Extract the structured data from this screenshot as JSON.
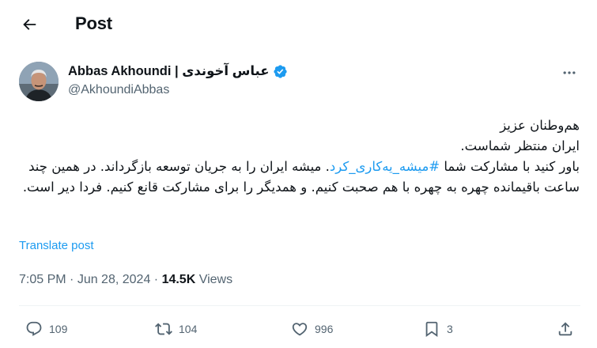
{
  "header": {
    "title": "Post"
  },
  "author": {
    "display_name": "Abbas Akhoundi | عباس آخوندی",
    "handle": "@AkhoundiAbbas"
  },
  "tweet": {
    "line1": "هم‌وطنان عزیز",
    "line2": "ایران منتظر شماست.",
    "para_part1": "باور کنید با مشارکت شما ",
    "hashtag": "#میشه_یه‌کاری_کرد",
    "para_part2": ". میشه ایران را به جریان توسعه بازگرداند. در همین چند ساعت باقیمانده چهره به چهره با هم صحبت کنیم. و همدیگر را برای مشارکت قانع کنیم. فردا دیر است."
  },
  "translate_label": "Translate post",
  "meta": {
    "time": "7:05 PM",
    "separator": " · ",
    "date": "Jun 28, 2024",
    "views_count": "14.5K",
    "views_label": " Views"
  },
  "actions": {
    "replies": "109",
    "reposts": "104",
    "likes": "996",
    "bookmarks": "3"
  },
  "colors": {
    "accent": "#1d9bf0",
    "text": "#0f1419",
    "muted": "#536471",
    "divider": "#eff3f4"
  },
  "icons": [
    "back-arrow-icon",
    "verified-badge-icon",
    "more-icon",
    "reply-icon",
    "repost-icon",
    "like-icon",
    "bookmark-icon",
    "share-icon"
  ]
}
